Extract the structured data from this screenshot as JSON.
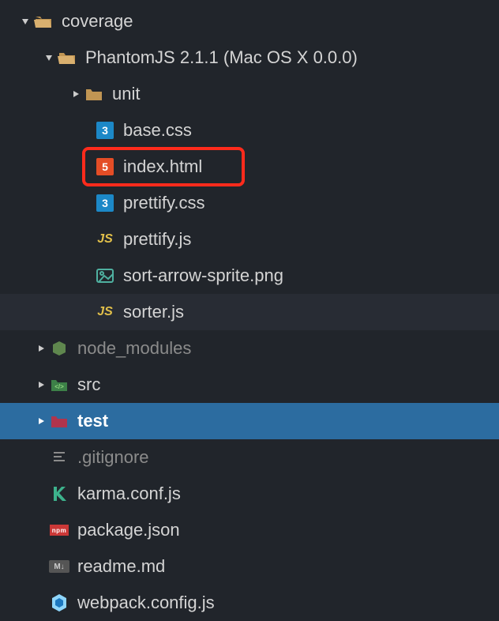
{
  "tree": {
    "coverage": "coverage",
    "phantomjs": "PhantomJS 2.1.1 (Mac OS X 0.0.0)",
    "unit": "unit",
    "base_css": "base.css",
    "index_html": "index.html",
    "prettify_css": "prettify.css",
    "prettify_js": "prettify.js",
    "sort_arrow": "sort-arrow-sprite.png",
    "sorter_js": "sorter.js",
    "node_modules": "node_modules",
    "src": "src",
    "test": "test",
    "gitignore": ".gitignore",
    "karma": "karma.conf.js",
    "package_json": "package.json",
    "readme": "readme.md",
    "webpack": "webpack.config.js"
  }
}
